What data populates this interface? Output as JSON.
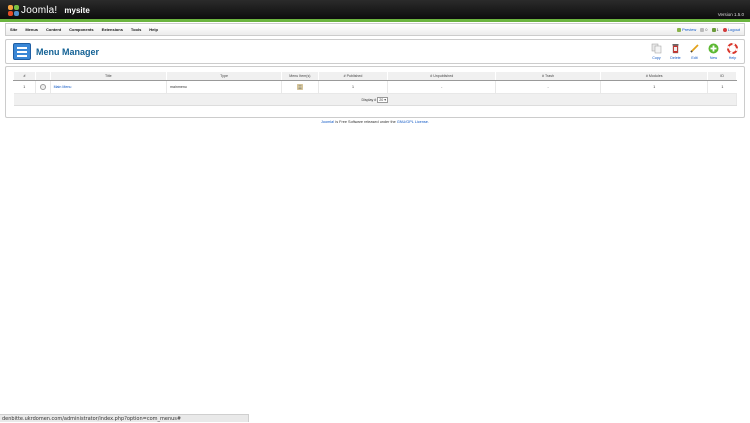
{
  "header": {
    "logo_text": "Joomla!",
    "site_name": "mysite",
    "version": "Version 1.5.0"
  },
  "menubar": {
    "items": [
      "Site",
      "Menus",
      "Content",
      "Components",
      "Extensions",
      "Tools",
      "Help"
    ]
  },
  "status": {
    "preview": "Preview",
    "messages": "0",
    "users": "1",
    "logout": "Logout"
  },
  "page": {
    "title": "Menu Manager"
  },
  "toolbar": {
    "copy": "Copy",
    "delete": "Delete",
    "edit": "Edit",
    "new": "New",
    "help": "Help"
  },
  "table": {
    "headers": [
      "#",
      "",
      "Title",
      "Type",
      "Menu Item(s)",
      "# Published",
      "# Unpublished",
      "# Trash",
      "# Modules",
      "ID"
    ],
    "rows": [
      {
        "num": "1",
        "title": "Main Menu",
        "type": "mainmenu",
        "published": "1",
        "unpublished": "-",
        "trash": "-",
        "modules": "1",
        "id": "1"
      }
    ],
    "display_label": "Display #",
    "display_value": "20"
  },
  "footer": {
    "joomla_link": "Joomla!",
    "text_mid": " is Free Software released under the ",
    "license_link": "GNU/GPL License."
  },
  "statusbar": {
    "url": "denbitte.ukrdomen.com/administrator/index.php?option=com_menus#"
  },
  "colors": {
    "accent_green": "#6bb43f",
    "title_blue": "#146295",
    "link_blue": "#0b55c4"
  }
}
